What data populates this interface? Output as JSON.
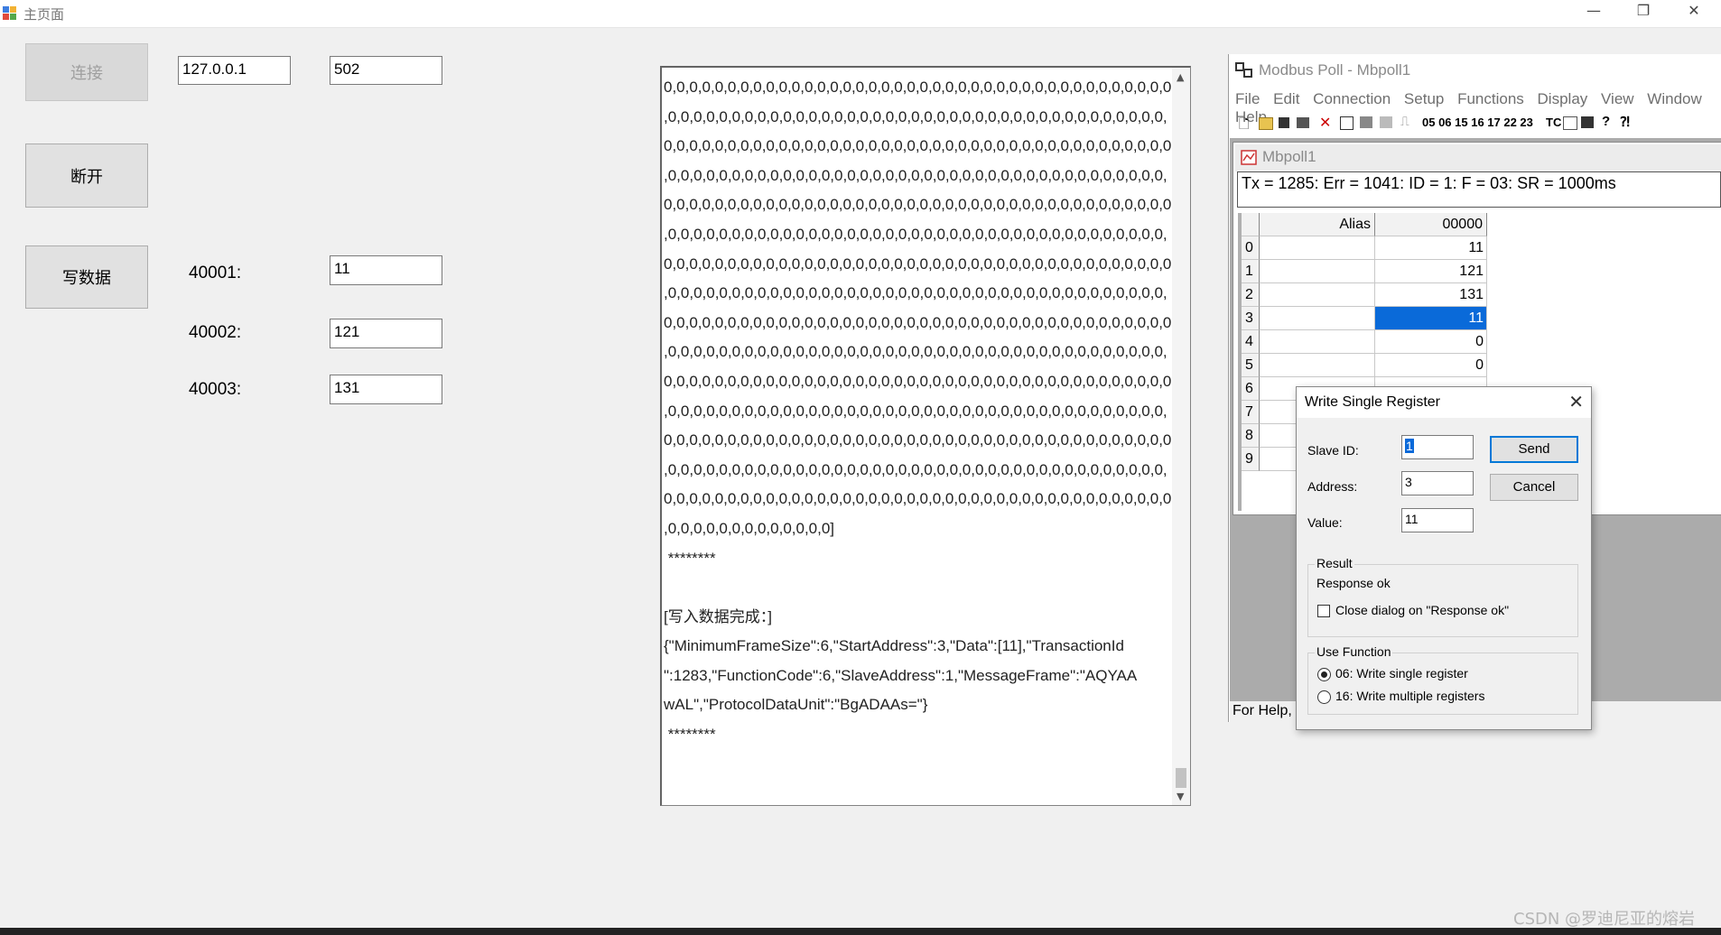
{
  "window": {
    "title": "主页面",
    "minimize": "—",
    "restore": "❐",
    "close": "✕"
  },
  "left_panel": {
    "connect_label": "连接",
    "disconnect_label": "断开",
    "write_label": "写数据",
    "ip_value": "127.0.0.1",
    "port_value": "502",
    "registers": [
      {
        "label": "40001:",
        "value": "11"
      },
      {
        "label": "40002:",
        "value": "121"
      },
      {
        "label": "40003:",
        "value": "131"
      }
    ]
  },
  "log": {
    "lines": [
      "0,0,0,0,0,0,0,0,0,0,0,0,0,0,0,0,0,0,0,0,0,0,0,0,0,0,0,0,0,0,0,0,0,0,0,0,0,0,0,0",
      ",0,0,0,0,0,0,0,0,0,0,0,0,0,0,0,0,0,0,0,0,0,0,0,0,0,0,0,0,0,0,0,0,0,0,0,0,0,0,0,",
      "0,0,0,0,0,0,0,0,0,0,0,0,0,0,0,0,0,0,0,0,0,0,0,0,0,0,0,0,0,0,0,0,0,0,0,0,0,0,0,0",
      ",0,0,0,0,0,0,0,0,0,0,0,0,0,0,0,0,0,0,0,0,0,0,0,0,0,0,0,0,0,0,0,0,0,0,0,0,0,0,0,",
      "0,0,0,0,0,0,0,0,0,0,0,0,0,0,0,0,0,0,0,0,0,0,0,0,0,0,0,0,0,0,0,0,0,0,0,0,0,0,0,0",
      ",0,0,0,0,0,0,0,0,0,0,0,0,0,0,0,0,0,0,0,0,0,0,0,0,0,0,0,0,0,0,0,0,0,0,0,0,0,0,0,",
      "0,0,0,0,0,0,0,0,0,0,0,0,0,0,0,0,0,0,0,0,0,0,0,0,0,0,0,0,0,0,0,0,0,0,0,0,0,0,0,0",
      ",0,0,0,0,0,0,0,0,0,0,0,0,0,0,0,0,0,0,0,0,0,0,0,0,0,0,0,0,0,0,0,0,0,0,0,0,0,0,0,",
      "0,0,0,0,0,0,0,0,0,0,0,0,0,0,0,0,0,0,0,0,0,0,0,0,0,0,0,0,0,0,0,0,0,0,0,0,0,0,0,0",
      ",0,0,0,0,0,0,0,0,0,0,0,0,0,0,0,0,0,0,0,0,0,0,0,0,0,0,0,0,0,0,0,0,0,0,0,0,0,0,0,",
      "0,0,0,0,0,0,0,0,0,0,0,0,0,0,0,0,0,0,0,0,0,0,0,0,0,0,0,0,0,0,0,0,0,0,0,0,0,0,0,0",
      ",0,0,0,0,0,0,0,0,0,0,0,0,0,0,0,0,0,0,0,0,0,0,0,0,0,0,0,0,0,0,0,0,0,0,0,0,0,0,0,",
      "0,0,0,0,0,0,0,0,0,0,0,0,0,0,0,0,0,0,0,0,0,0,0,0,0,0,0,0,0,0,0,0,0,0,0,0,0,0,0,0",
      ",0,0,0,0,0,0,0,0,0,0,0,0,0,0,0,0,0,0,0,0,0,0,0,0,0,0,0,0,0,0,0,0,0,0,0,0,0,0,0,",
      "0,0,0,0,0,0,0,0,0,0,0,0,0,0,0,0,0,0,0,0,0,0,0,0,0,0,0,0,0,0,0,0,0,0,0,0,0,0,0,0",
      ",0,0,0,0,0,0,0,0,0,0,0,0,0]",
      " ********",
      "",
      "[写入数据完成：]",
      "{\"MinimumFrameSize\":6,\"StartAddress\":3,\"Data\":[11],\"TransactionId",
      "\":1283,\"FunctionCode\":6,\"SlaveAddress\":1,\"MessageFrame\":\"AQYAA",
      "wAL\",\"ProtocolDataUnit\":\"BgADAAs=\"}",
      " ********"
    ]
  },
  "modbus": {
    "app_title": "Modbus Poll - Mbpoll1",
    "menu": [
      "File",
      "Edit",
      "Connection",
      "Setup",
      "Functions",
      "Display",
      "View",
      "Window",
      "Help"
    ],
    "toolbar_codes": "05 06 15 16 17 22 23",
    "toolbar_tc": "TC",
    "child_title": "Mbpoll1",
    "status": "Tx = 1285: Err = 1041: ID = 1: F = 03: SR = 1000ms",
    "col_alias": "Alias",
    "col_addr": "00000",
    "rows": [
      {
        "idx": "0",
        "value": "11"
      },
      {
        "idx": "1",
        "value": "121"
      },
      {
        "idx": "2",
        "value": "131"
      },
      {
        "idx": "3",
        "value": "11"
      },
      {
        "idx": "4",
        "value": "0"
      },
      {
        "idx": "5",
        "value": "0"
      },
      {
        "idx": "6",
        "value": ""
      },
      {
        "idx": "7",
        "value": ""
      },
      {
        "idx": "8",
        "value": ""
      },
      {
        "idx": "9",
        "value": ""
      }
    ],
    "statusbar": "For Help,"
  },
  "dialog": {
    "title": "Write Single Register",
    "slave_label": "Slave ID:",
    "slave_value": "1",
    "address_label": "Address:",
    "address_value": "3",
    "value_label": "Value:",
    "value_value": "11",
    "send": "Send",
    "cancel": "Cancel",
    "result_title": "Result",
    "result_text": "Response ok",
    "close_dialog": "Close dialog on \"Response ok\"",
    "use_function_title": "Use Function",
    "fn06": "06: Write single register",
    "fn16": "16: Write multiple registers"
  },
  "watermark": "CSDN @罗迪尼亚的熔岩"
}
